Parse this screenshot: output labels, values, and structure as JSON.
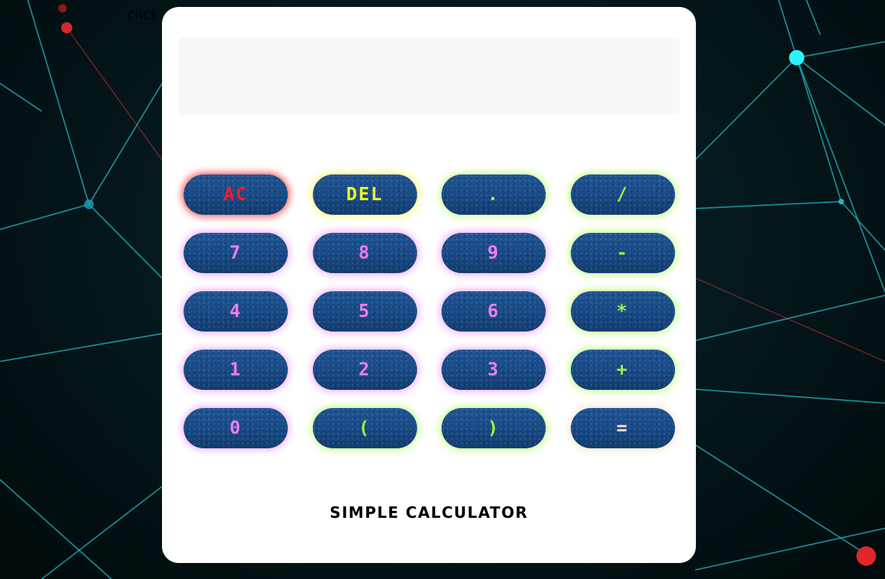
{
  "hint_text": "click",
  "display": {
    "value": ""
  },
  "keys": {
    "ac": "AC",
    "del": "DEL",
    "dot": ".",
    "divide": "/",
    "seven": "7",
    "eight": "8",
    "nine": "9",
    "minus": "-",
    "four": "4",
    "five": "5",
    "six": "6",
    "multiply": "*",
    "one": "1",
    "two": "2",
    "three": "3",
    "plus": "+",
    "zero": "0",
    "open_paren": "(",
    "close_paren": ")",
    "equals": "="
  },
  "title": "SIMPLE CALCULATOR",
  "colors": {
    "ac": "#ff1a2a",
    "del": "#f2f52a",
    "operator": "#9ef23a",
    "digit": "#ee7de8",
    "equals": "#f6e7d2",
    "key_background": "#184a86",
    "background_lines": "#1fb7c4",
    "background_nodes_red": "#ff2a2a"
  }
}
